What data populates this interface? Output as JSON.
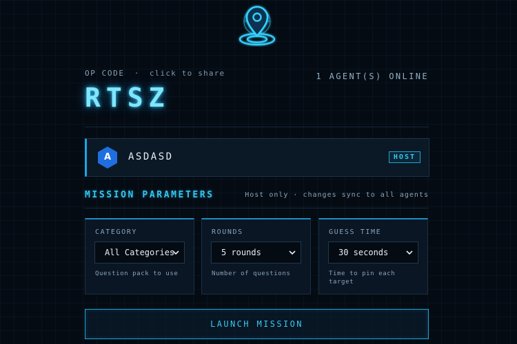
{
  "logo": {
    "icon": "location-pin-globe-icon"
  },
  "op": {
    "label": "OP CODE",
    "separator": "·",
    "hint": "click to share",
    "code": "RTSZ",
    "agents_online": "1 AGENT(S) ONLINE"
  },
  "player": {
    "initial": "A",
    "name": "ASDASD",
    "badge": "HOST"
  },
  "mission": {
    "title": "MISSION PARAMETERS",
    "note": "Host only · changes sync to all agents",
    "params": [
      {
        "label": "CATEGORY",
        "value": "All Categories",
        "hint": "Question pack to use"
      },
      {
        "label": "ROUNDS",
        "value": "5 rounds",
        "hint": "Number of questions"
      },
      {
        "label": "GUESS TIME",
        "value": "30 seconds",
        "hint": "Time to pin each target"
      }
    ]
  },
  "launch_label": "LAUNCH MISSION",
  "colors": {
    "accent": "#33c6ee",
    "background": "#050b13",
    "avatar": "#1f6fe0"
  }
}
